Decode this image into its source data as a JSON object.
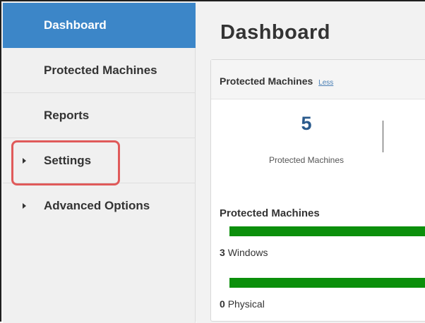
{
  "sidebar": {
    "items": [
      {
        "label": "Dashboard",
        "active": true,
        "expandable": false
      },
      {
        "label": "Protected Machines",
        "active": false,
        "expandable": false
      },
      {
        "label": "Reports",
        "active": false,
        "expandable": false
      },
      {
        "label": "Settings",
        "active": false,
        "expandable": true,
        "highlighted": true
      },
      {
        "label": "Advanced Options",
        "active": false,
        "expandable": true
      }
    ]
  },
  "main": {
    "title": "Dashboard",
    "card": {
      "title": "Protected Machines",
      "toggle_link": "Less",
      "stat": {
        "value": "5",
        "label": "Protected Machines"
      },
      "section_title": "Protected Machines",
      "rows": [
        {
          "count": "3",
          "label": "Windows"
        },
        {
          "count": "0",
          "label": "Physical"
        }
      ]
    }
  },
  "colors": {
    "active_nav": "#3c86c8",
    "highlight": "#e05a5a",
    "bar": "#0b8f0b",
    "stat_number": "#2a5a8c",
    "link": "#4a7fb5"
  }
}
